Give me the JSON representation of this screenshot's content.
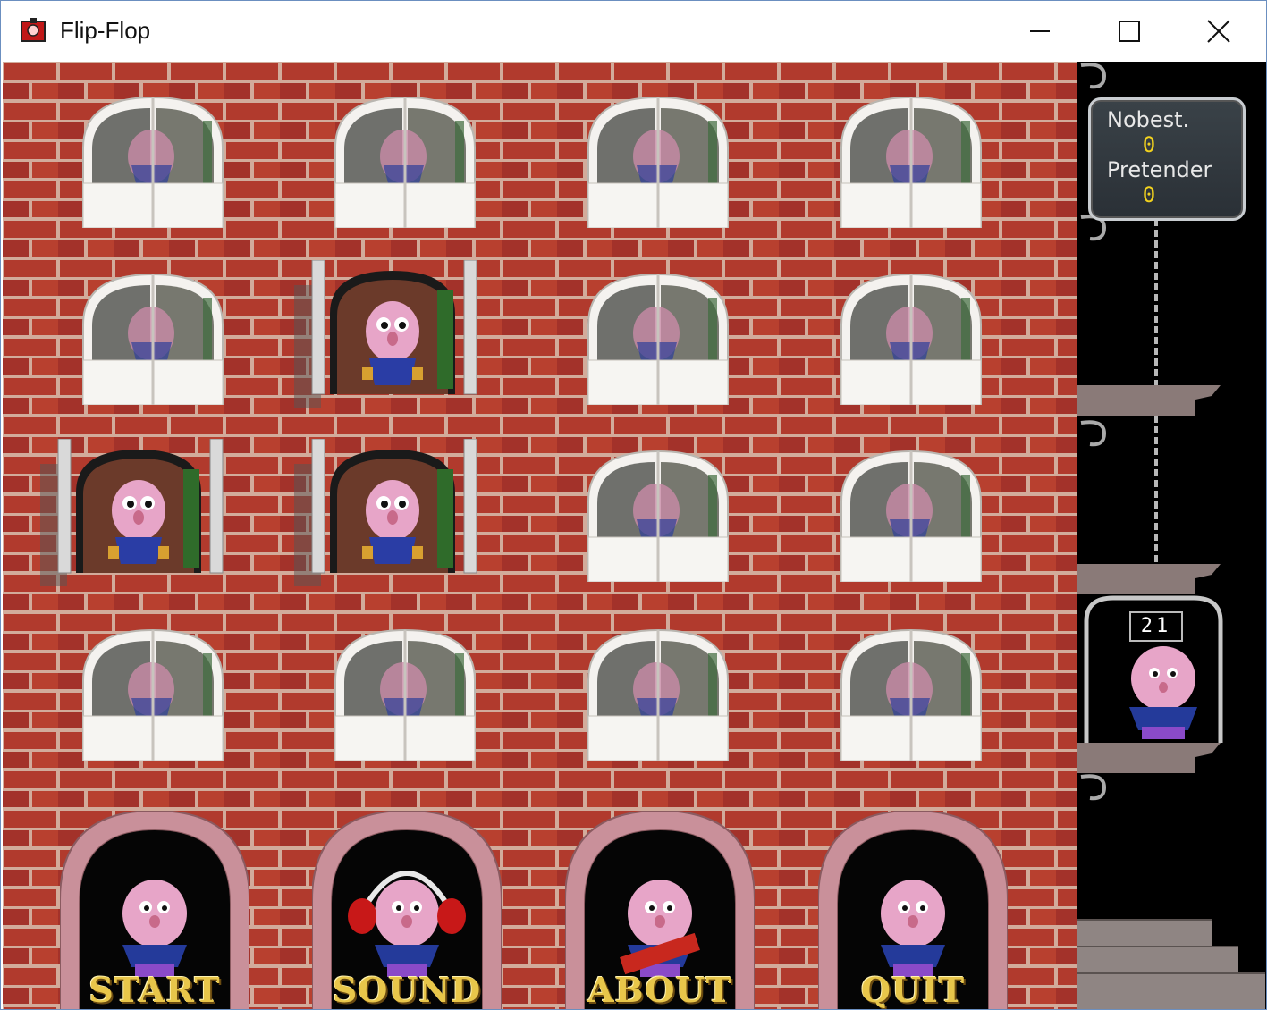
{
  "window": {
    "title": "Flip-Flop",
    "controls": {
      "minimize": "minimize",
      "maximize": "maximize",
      "close": "close"
    }
  },
  "scoreboard": {
    "best_label": "Nobest.",
    "best_value": "0",
    "player_label": "Pretender",
    "player_value": "0"
  },
  "elevator": {
    "counter": "21"
  },
  "grid": {
    "rows": [
      [
        "closed",
        "closed",
        "closed",
        "closed"
      ],
      [
        "closed",
        "open",
        "closed",
        "closed"
      ],
      [
        "open",
        "open",
        "closed",
        "closed"
      ],
      [
        "closed",
        "closed",
        "closed",
        "closed"
      ]
    ]
  },
  "doors": [
    {
      "label": "START"
    },
    {
      "label": "SOUND"
    },
    {
      "label": "ABOUT"
    },
    {
      "label": "QUIT"
    }
  ],
  "colors": {
    "brick": "#a8352a",
    "mortar": "#d9b7a6",
    "label_gold": "#e8c64a",
    "score_yellow": "#f2d21e"
  }
}
